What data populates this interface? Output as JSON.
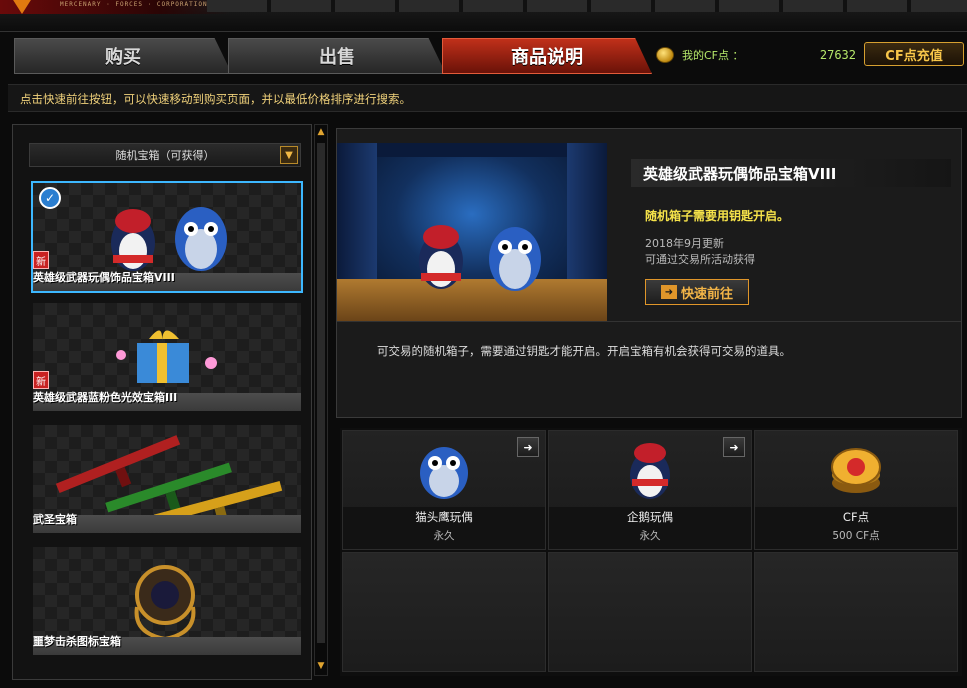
{
  "banner": {
    "corp_text": "MERCENARY · FORCES · CORPORATION"
  },
  "tabs": [
    {
      "label": "购买",
      "active": false
    },
    {
      "label": "出售",
      "active": false
    },
    {
      "label": "商品说明",
      "active": true
    }
  ],
  "account": {
    "cf_label": "我的CF点 ：",
    "cf_value": "27632",
    "recharge_label": "CF点充值"
  },
  "hint": "点击快速前往按钮，可以快速移动到购买页面，并以最低价格排序进行搜索。",
  "filter": {
    "selected": "随机宝箱（可获得）"
  },
  "list": [
    {
      "name": "英雄级武器玩偶饰品宝箱VIII",
      "is_new": true,
      "selected": true,
      "new_badge": "新"
    },
    {
      "name": "英雄级武器蓝粉色光效宝箱III",
      "is_new": true,
      "selected": false,
      "new_badge": "新"
    },
    {
      "name": "武圣宝箱",
      "is_new": false,
      "selected": false
    },
    {
      "name": "噩梦击杀图标宝箱",
      "is_new": false,
      "selected": false
    }
  ],
  "detail": {
    "title": "英雄级武器玩偶饰品宝箱VIII",
    "requirement": "随机箱子需要用钥匙开启。",
    "update": "2018年9月更新",
    "obtain": "可通过交易所活动获得",
    "goto_label": "快速前往",
    "description": "可交易的随机箱子，需要通过钥匙才能开启。开启宝箱有机会获得可交易的道具。"
  },
  "rewards": [
    {
      "name": "猫头鹰玩偶",
      "duration": "永久",
      "has_jump": true,
      "icon": "owl-doll-icon"
    },
    {
      "name": "企鹅玩偶",
      "duration": "永久",
      "has_jump": true,
      "icon": "penguin-doll-icon"
    },
    {
      "name": "CF点",
      "duration": "500 CF点",
      "has_jump": false,
      "icon": "cf-coin-icon"
    }
  ],
  "colors": {
    "accent": "#e0962a",
    "active_tab": "#c0301a",
    "highlight": "#f6e34a",
    "points": "#b6e86a"
  }
}
